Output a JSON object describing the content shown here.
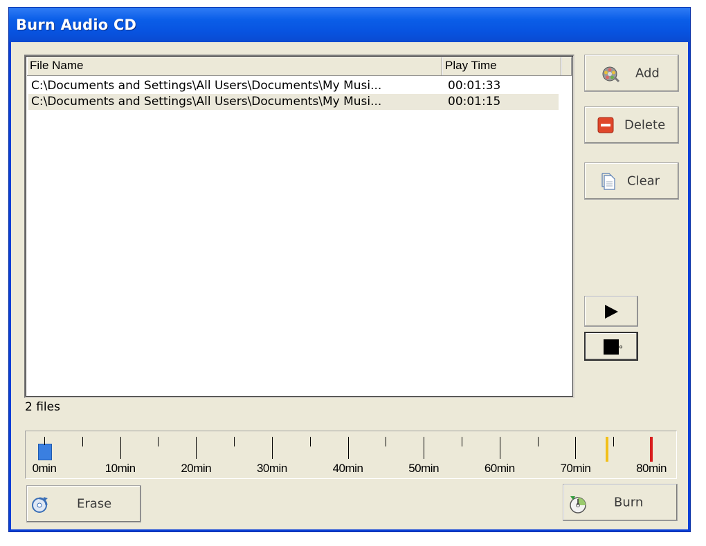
{
  "window": {
    "title": "Burn Audio CD"
  },
  "list": {
    "columns": [
      "File Name",
      "Play Time"
    ],
    "rows": [
      {
        "name": "C:\\Documents and Settings\\All Users\\Documents\\My Musi...",
        "time": "00:01:33"
      },
      {
        "name": "C:\\Documents and Settings\\All Users\\Documents\\My Musi...",
        "time": "00:01:15"
      }
    ],
    "status": "2 files"
  },
  "buttons": {
    "add": "Add",
    "delete": "Delete",
    "clear": "Clear",
    "erase": "Erase",
    "burn": "Burn"
  },
  "timeline": {
    "labels": [
      "0min",
      "10min",
      "20min",
      "30min",
      "40min",
      "50min",
      "60min",
      "70min",
      "80min"
    ],
    "used_minutes": 2.8,
    "warning_minutes": 74,
    "limit_minutes": 80,
    "colors": {
      "used": "#3a7fe0",
      "warning": "#f2c01a",
      "limit": "#d81e1e"
    }
  },
  "icons": {
    "add": "film-reel-icon",
    "delete": "minus-red-icon",
    "clear": "document-icon",
    "play": "play-icon",
    "stop": "stop-icon",
    "erase": "disc-erase-icon",
    "burn": "disc-burn-icon"
  }
}
